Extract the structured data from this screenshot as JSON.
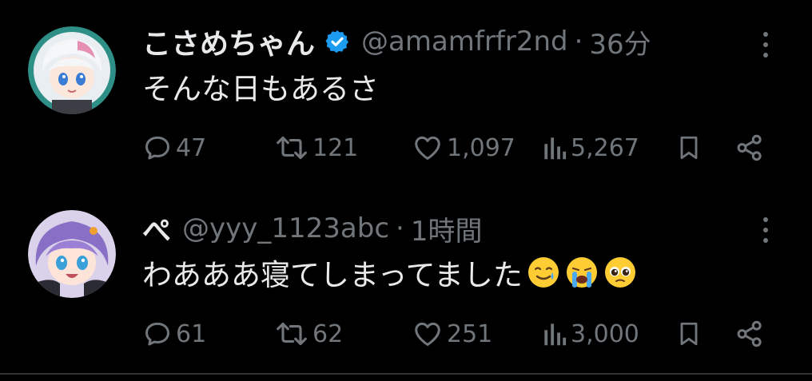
{
  "colors": {
    "background": "#000000",
    "primary_text": "#e7e9ea",
    "secondary_text": "#71767b",
    "divider": "#2f3336",
    "verified_blue": "#1d9bf0"
  },
  "tweets": [
    {
      "display_name": "こさめちゃん",
      "verified": true,
      "handle": "@amamfrfr2nd",
      "separator": "·",
      "time": "36分",
      "text": "そんな日もあるさ",
      "emojis": [],
      "avatar_icon": "avatar-white-hair",
      "stats": {
        "replies": "47",
        "retweets": "121",
        "likes": "1,097",
        "views": "5,267"
      }
    },
    {
      "display_name": "ぺ",
      "verified": false,
      "handle": "@yyy_1123abc",
      "separator": "·",
      "time": "1時間",
      "text": "わあああ寝てしまってました",
      "emojis": [
        "smiling-face-with-tear-emoji",
        "loudly-crying-face-emoji",
        "pleading-face-emoji"
      ],
      "avatar_icon": "avatar-purple-hair",
      "stats": {
        "replies": "61",
        "retweets": "62",
        "likes": "251",
        "views": "3,000"
      }
    }
  ],
  "icons": {
    "reply": "speech-bubble-icon",
    "retweet": "retweet-arrows-icon",
    "like": "heart-icon",
    "views": "bar-chart-icon",
    "bookmark": "bookmark-icon",
    "share": "share-icon",
    "more": "more-dots-icon"
  }
}
